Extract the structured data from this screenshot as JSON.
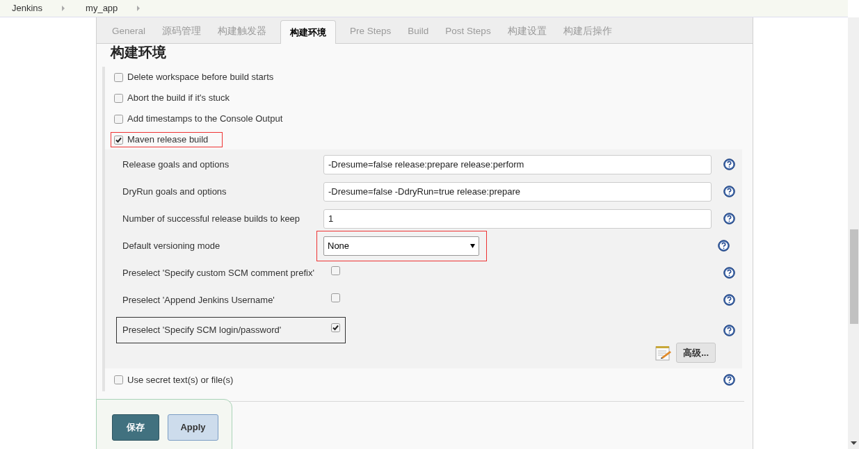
{
  "breadcrumbs": [
    "Jenkins",
    "my_app"
  ],
  "tabs": [
    {
      "label": "General",
      "selected": false
    },
    {
      "label": "源码管理",
      "selected": false
    },
    {
      "label": "构建触发器",
      "selected": false
    },
    {
      "label": "构建环境",
      "selected": true
    },
    {
      "label": "Pre Steps",
      "selected": false
    },
    {
      "label": "Build",
      "selected": false
    },
    {
      "label": "Post Steps",
      "selected": false
    },
    {
      "label": "构建设置",
      "selected": false
    },
    {
      "label": "构建后操作",
      "selected": false
    }
  ],
  "section_title": "构建环境",
  "options": [
    {
      "label": "Delete workspace before build starts",
      "checked": false
    },
    {
      "label": "Abort the build if it's stuck",
      "checked": false
    },
    {
      "label": "Add timestamps to the Console Output",
      "checked": false
    },
    {
      "label": "Maven release build",
      "checked": true,
      "highlighted": true
    }
  ],
  "maven_fields": [
    {
      "kind": "text",
      "label": "Release goals and options",
      "value": "-Dresume=false release:prepare release:perform"
    },
    {
      "kind": "text",
      "label": "DryRun goals and options",
      "value": "-Dresume=false -DdryRun=true release:prepare"
    },
    {
      "kind": "text",
      "label": "Number of successful release builds to keep",
      "value": "1"
    },
    {
      "kind": "select",
      "label": "Default versioning mode",
      "value": "None",
      "highlighted": true
    },
    {
      "kind": "checkbox",
      "label": "Preselect 'Specify custom SCM comment prefix'",
      "checked": false
    },
    {
      "kind": "checkbox",
      "label": "Preselect 'Append Jenkins Username'",
      "checked": false
    },
    {
      "kind": "checkbox",
      "label": "Preselect 'Specify SCM login/password'",
      "checked": true,
      "highlighted": true
    }
  ],
  "advanced_button": "高级...",
  "after_options": [
    {
      "label": "Use secret text(s) or file(s)",
      "checked": false
    }
  ],
  "save_bar": {
    "save": "保存",
    "apply": "Apply"
  }
}
